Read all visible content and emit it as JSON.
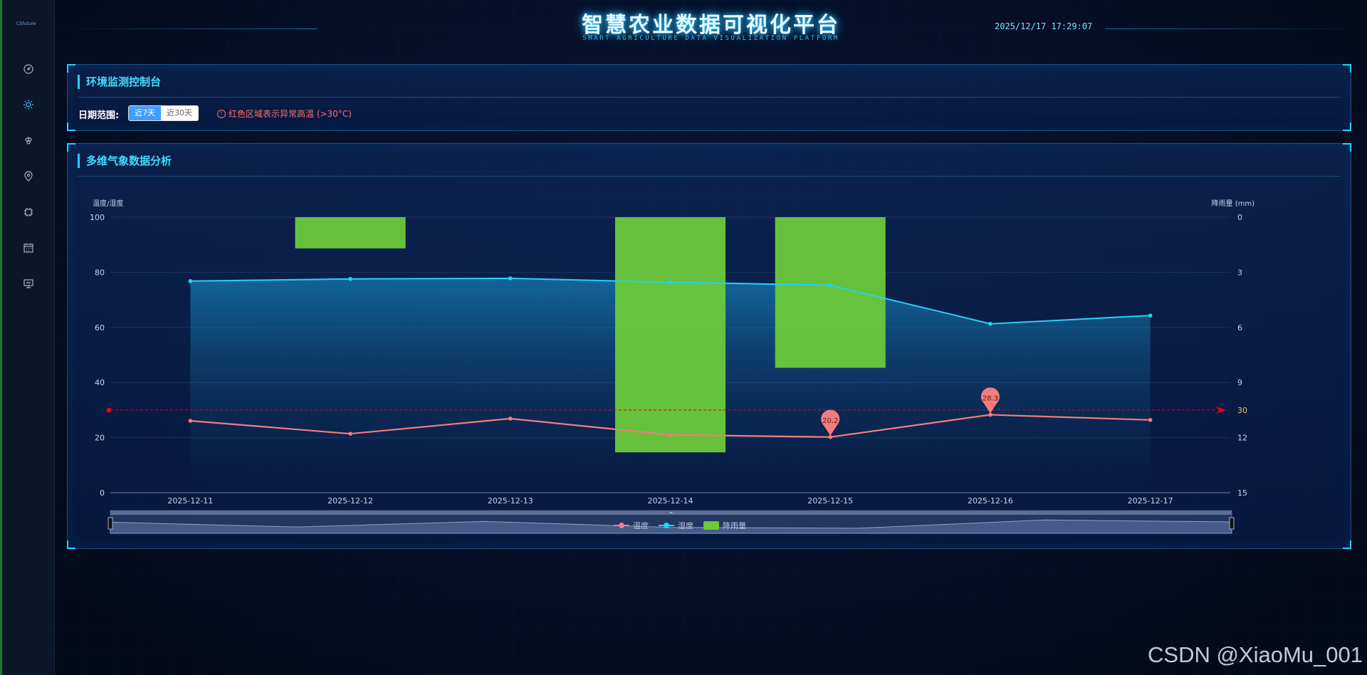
{
  "header": {
    "title": "智慧农业数据可视化平台",
    "subtitle": "SMART AGRICULTURE DATA VISUALIZATION PLATFORM",
    "datetime": "2025/12/17 17:29:07"
  },
  "sidebar": {
    "logo_text": "CSfuture",
    "items": [
      {
        "icon": "dashboard-icon"
      },
      {
        "icon": "sun-icon",
        "active": true
      },
      {
        "icon": "grape-icon"
      },
      {
        "icon": "location-icon"
      },
      {
        "icon": "chip-icon"
      },
      {
        "icon": "calendar-icon"
      },
      {
        "icon": "presentation-icon"
      }
    ]
  },
  "control_panel": {
    "title": "环境监测控制台",
    "range_label": "日期范围:",
    "range_options": [
      "近7天",
      "近30天"
    ],
    "range_selected": "近7天",
    "hint": "红色区域表示异常高温 (>30°C)",
    "warn_icon": "!"
  },
  "chart_panel": {
    "title": "多维气象数据分析"
  },
  "chart_data": {
    "type": "line",
    "categories": [
      "2025-12-11",
      "2025-12-12",
      "2025-12-13",
      "2025-12-14",
      "2025-12-15",
      "2025-12-16",
      "2025-12-17"
    ],
    "y_left": {
      "label": "温度/湿度",
      "ylim": [
        0,
        100
      ],
      "ticks": [
        0,
        20,
        40,
        60,
        80,
        100
      ]
    },
    "y_right": {
      "label": "降雨量 (mm)",
      "ylim": [
        0,
        15
      ],
      "ticks": [
        0,
        3,
        6,
        9,
        12,
        15
      ],
      "inverse": true
    },
    "series": [
      {
        "name": "温度",
        "type": "line",
        "axis": "left",
        "color": "#f47c7c",
        "values": [
          26.1,
          21.4,
          26.9,
          21.0,
          20.2,
          28.3,
          26.4
        ]
      },
      {
        "name": "湿度",
        "type": "area",
        "axis": "left",
        "color": "#23d3f5",
        "values": [
          76.8,
          77.6,
          77.8,
          76.4,
          75.3,
          61.3,
          64.3
        ]
      },
      {
        "name": "降雨量",
        "type": "bar",
        "axis": "right",
        "color": "#6cc93a",
        "values": [
          0,
          1.7,
          0,
          12.8,
          8.2,
          0,
          0
        ]
      }
    ],
    "mark_points": [
      {
        "series": "温度",
        "category": "2025-12-15",
        "value": 20.2,
        "label": "20.2"
      },
      {
        "series": "温度",
        "category": "2025-12-16",
        "value": 28.3,
        "label": "28.3"
      }
    ],
    "mark_line": {
      "axis": "left",
      "value": 30,
      "label": "30",
      "color": "#e8001c"
    },
    "legend": {
      "position": "bottom-center",
      "items": [
        "温度",
        "湿度",
        "降雨量"
      ]
    },
    "grid": true,
    "data_zoom": {
      "start": 0,
      "end": 100,
      "handle_label": "═"
    }
  },
  "watermark": "CSDN @XiaoMu_001"
}
